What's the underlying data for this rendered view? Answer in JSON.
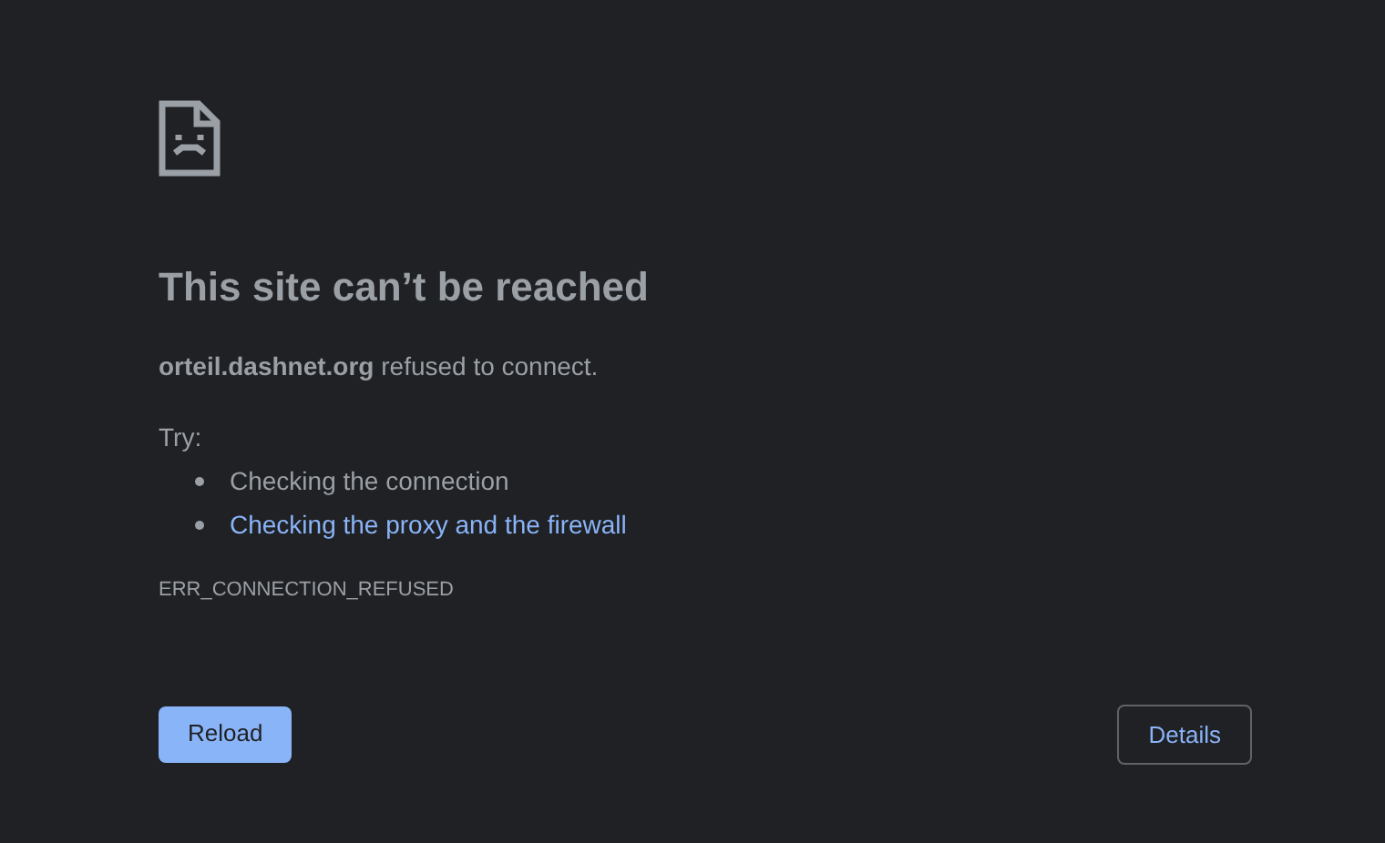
{
  "title": "This site can’t be reached",
  "message": "**orteil.dashnet.org** refused to connect.",
  "try_label": "Try:",
  "suggestions": [
    {
      "kind": "text",
      "text": "Checking the connection"
    },
    {
      "kind": "link",
      "text": "Checking the proxy and the firewall"
    }
  ],
  "error_code": "ERR_CONNECTION_REFUSED",
  "buttons": [
    {
      "kind": "primary",
      "label": "Reload"
    },
    {
      "kind": "secondary",
      "label": "Details"
    }
  ]
}
